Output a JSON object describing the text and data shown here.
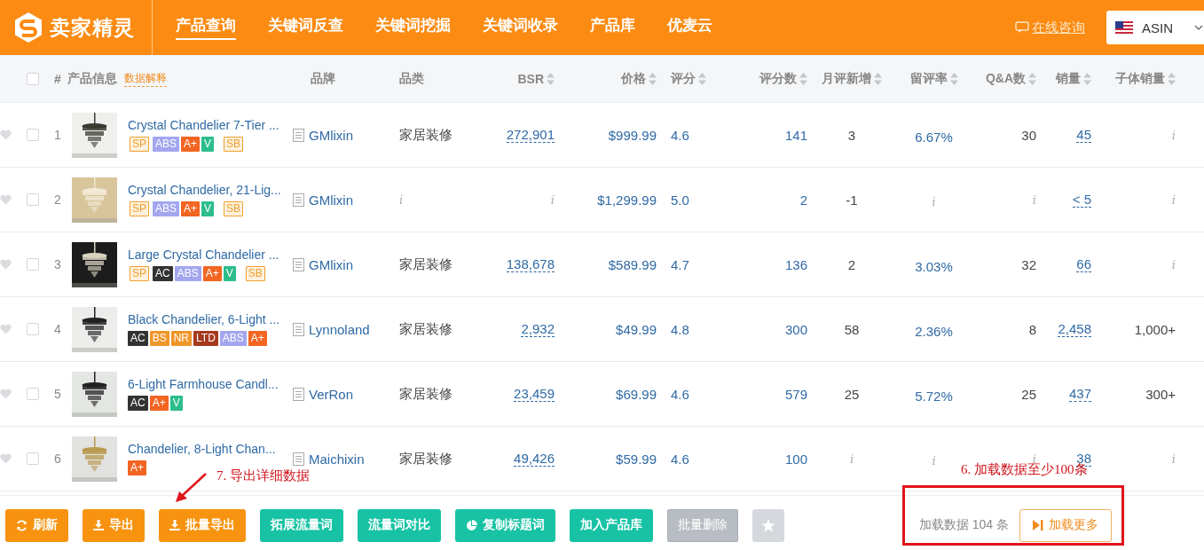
{
  "header": {
    "logo": "卖家精灵",
    "nav": [
      {
        "label": "产品查询",
        "selected": true
      },
      {
        "label": "关键词反查",
        "selected": false
      },
      {
        "label": "关键词挖掘",
        "selected": false
      },
      {
        "label": "关键词收录",
        "selected": false
      },
      {
        "label": "产品库",
        "selected": false
      },
      {
        "label": "优麦云",
        "selected": false
      }
    ],
    "consult": "在线咨询",
    "market_select": {
      "value": "ASIN"
    }
  },
  "table": {
    "select_all_checked": false,
    "columns": [
      {
        "label": "#",
        "sortable": false
      },
      {
        "label": "产品信息",
        "hint": "数据解释",
        "sortable": false
      },
      {
        "label": "品牌",
        "sortable": false
      },
      {
        "label": "品类",
        "sortable": false
      },
      {
        "label": "BSR",
        "sortable": true
      },
      {
        "label": "价格",
        "sortable": true
      },
      {
        "label": "评分",
        "sortable": true
      },
      {
        "label": "评分数",
        "sortable": true
      },
      {
        "label": "月评新增",
        "sortable": true
      },
      {
        "label": "留评率",
        "sortable": true
      },
      {
        "label": "Q&A数",
        "sortable": true
      },
      {
        "label": "销量",
        "sortable": true
      },
      {
        "label": "子体销量",
        "sortable": true
      }
    ],
    "rows": [
      {
        "favorited": false,
        "checked": false,
        "cells": [
          {
            "text": "1",
            "kind": "index"
          },
          {
            "kind": "product",
            "image": {
              "kind": "picture"
            },
            "title": "Crystal Chandelier 7-Tier ...",
            "tags": [
              {
                "text": "SP",
                "kind": "outline",
                "color": "#f0a030"
              },
              {
                "text": "ABS",
                "kind": "solid",
                "color": "#a3a6ee"
              },
              {
                "text": "A+",
                "kind": "solid",
                "color": "#f26522"
              },
              {
                "text": "V",
                "kind": "solid",
                "color": "#2dbd8a"
              },
              {
                "text": "SB",
                "kind": "outline",
                "color": "#f0a030"
              }
            ]
          },
          {
            "text": "GMlixin",
            "kind": "brand"
          },
          {
            "text": "家居装修",
            "kind": "plain"
          },
          {
            "text": "272,901",
            "kind": "link"
          },
          {
            "text": "$999.99",
            "kind": "value"
          },
          {
            "text": "4.6",
            "kind": "value"
          },
          {
            "text": "141",
            "kind": "value"
          },
          {
            "text": "3",
            "kind": "plain"
          },
          {
            "text": "6.67%",
            "kind": "value"
          },
          {
            "text": "30",
            "kind": "plain"
          },
          {
            "text": "45",
            "kind": "link"
          },
          {
            "text": "i",
            "kind": "na"
          }
        ]
      },
      {
        "favorited": false,
        "checked": false,
        "cells": [
          {
            "text": "2",
            "kind": "index"
          },
          {
            "kind": "product",
            "image": {
              "kind": "picture"
            },
            "title": "Crystal Chandelier, 21-Lig...",
            "tags": [
              {
                "text": "SP",
                "kind": "outline",
                "color": "#f0a030"
              },
              {
                "text": "ABS",
                "kind": "solid",
                "color": "#a3a6ee"
              },
              {
                "text": "A+",
                "kind": "solid",
                "color": "#f26522"
              },
              {
                "text": "V",
                "kind": "solid",
                "color": "#2dbd8a"
              },
              {
                "text": "SB",
                "kind": "outline",
                "color": "#f0a030"
              }
            ]
          },
          {
            "text": "GMlixin",
            "kind": "brand"
          },
          {
            "text": "i",
            "kind": "na"
          },
          {
            "text": "i",
            "kind": "na"
          },
          {
            "text": "$1,299.99",
            "kind": "value"
          },
          {
            "text": "5.0",
            "kind": "value"
          },
          {
            "text": "2",
            "kind": "value"
          },
          {
            "text": "-1",
            "kind": "plain"
          },
          {
            "text": "i",
            "kind": "na"
          },
          {
            "text": "i",
            "kind": "na"
          },
          {
            "text": "< 5",
            "kind": "link"
          },
          {
            "text": "i",
            "kind": "na"
          }
        ]
      },
      {
        "favorited": false,
        "checked": false,
        "cells": [
          {
            "text": "3",
            "kind": "index"
          },
          {
            "kind": "product",
            "image": {
              "kind": "picture"
            },
            "title": "Large Crystal Chandelier ...",
            "tags": [
              {
                "text": "SP",
                "kind": "outline",
                "color": "#f0a030"
              },
              {
                "text": "AC",
                "kind": "solid",
                "color": "#333333"
              },
              {
                "text": "ABS",
                "kind": "solid",
                "color": "#a3a6ee"
              },
              {
                "text": "A+",
                "kind": "solid",
                "color": "#f26522"
              },
              {
                "text": "V",
                "kind": "solid",
                "color": "#2dbd8a"
              },
              {
                "text": "SB",
                "kind": "outline",
                "color": "#f0a030"
              }
            ]
          },
          {
            "text": "GMlixin",
            "kind": "brand"
          },
          {
            "text": "家居装修",
            "kind": "plain"
          },
          {
            "text": "138,678",
            "kind": "link"
          },
          {
            "text": "$589.99",
            "kind": "value"
          },
          {
            "text": "4.7",
            "kind": "value"
          },
          {
            "text": "136",
            "kind": "value"
          },
          {
            "text": "2",
            "kind": "plain"
          },
          {
            "text": "3.03%",
            "kind": "value"
          },
          {
            "text": "32",
            "kind": "plain"
          },
          {
            "text": "66",
            "kind": "link"
          },
          {
            "text": "i",
            "kind": "na"
          }
        ]
      },
      {
        "favorited": false,
        "checked": false,
        "cells": [
          {
            "text": "4",
            "kind": "index"
          },
          {
            "kind": "product",
            "image": {
              "kind": "picture"
            },
            "title": "Black Chandelier, 6-Light ...",
            "tags": [
              {
                "text": "AC",
                "kind": "solid",
                "color": "#333333"
              },
              {
                "text": "BS",
                "kind": "solid",
                "color": "#f0962a"
              },
              {
                "text": "NR",
                "kind": "solid",
                "color": "#f0962a"
              },
              {
                "text": "LTD",
                "kind": "solid",
                "color": "#a63a1e"
              },
              {
                "text": "ABS",
                "kind": "solid",
                "color": "#a3a6ee"
              },
              {
                "text": "A+",
                "kind": "solid",
                "color": "#f26522"
              }
            ]
          },
          {
            "text": "Lynnoland",
            "kind": "brand"
          },
          {
            "text": "家居装修",
            "kind": "plain"
          },
          {
            "text": "2,932",
            "kind": "link"
          },
          {
            "text": "$49.99",
            "kind": "value"
          },
          {
            "text": "4.8",
            "kind": "value"
          },
          {
            "text": "300",
            "kind": "value"
          },
          {
            "text": "58",
            "kind": "plain"
          },
          {
            "text": "2.36%",
            "kind": "value"
          },
          {
            "text": "8",
            "kind": "plain"
          },
          {
            "text": "2,458",
            "kind": "link"
          },
          {
            "text": "1,000+",
            "kind": "plain"
          }
        ]
      },
      {
        "favorited": false,
        "checked": false,
        "cells": [
          {
            "text": "5",
            "kind": "index"
          },
          {
            "kind": "product",
            "image": {
              "kind": "picture"
            },
            "title": "6-Light Farmhouse Candl...",
            "tags": [
              {
                "text": "AC",
                "kind": "solid",
                "color": "#333333"
              },
              {
                "text": "A+",
                "kind": "solid",
                "color": "#f26522"
              },
              {
                "text": "V",
                "kind": "solid",
                "color": "#2dbd8a"
              }
            ]
          },
          {
            "text": "VerRon",
            "kind": "brand"
          },
          {
            "text": "家居装修",
            "kind": "plain"
          },
          {
            "text": "23,459",
            "kind": "link"
          },
          {
            "text": "$69.99",
            "kind": "value"
          },
          {
            "text": "4.6",
            "kind": "value"
          },
          {
            "text": "579",
            "kind": "value"
          },
          {
            "text": "25",
            "kind": "plain"
          },
          {
            "text": "5.72%",
            "kind": "value"
          },
          {
            "text": "25",
            "kind": "plain"
          },
          {
            "text": "437",
            "kind": "link"
          },
          {
            "text": "300+",
            "kind": "plain"
          }
        ]
      },
      {
        "favorited": false,
        "checked": false,
        "cells": [
          {
            "text": "6",
            "kind": "index"
          },
          {
            "kind": "product",
            "image": {
              "kind": "picture"
            },
            "title": "Chandelier, 8-Light Chan...",
            "tags": [
              {
                "text": "A+",
                "kind": "solid",
                "color": "#f26522"
              }
            ]
          },
          {
            "text": "Maichixin",
            "kind": "brand"
          },
          {
            "text": "家居装修",
            "kind": "plain"
          },
          {
            "text": "49,426",
            "kind": "link"
          },
          {
            "text": "$59.99",
            "kind": "value"
          },
          {
            "text": "4.6",
            "kind": "value"
          },
          {
            "text": "100",
            "kind": "value"
          },
          {
            "text": "i",
            "kind": "na"
          },
          {
            "text": "i",
            "kind": "na"
          },
          {
            "text": "i",
            "kind": "na"
          },
          {
            "text": "38",
            "kind": "link"
          },
          {
            "text": "i",
            "kind": "na"
          }
        ]
      }
    ]
  },
  "action_bar": {
    "buttons": [
      {
        "label": "刷新",
        "kind": "refresh",
        "color": "#f7930f",
        "disabled": false
      },
      {
        "label": "导出",
        "kind": "download",
        "color": "#f7930f",
        "disabled": false
      },
      {
        "label": "批量导出",
        "kind": "download",
        "color": "#f7930f",
        "disabled": false
      },
      {
        "label": "拓展流量词",
        "kind": "plain",
        "color": "#17c3a4",
        "disabled": false
      },
      {
        "label": "流量词对比",
        "kind": "plain",
        "color": "#17c3a4",
        "disabled": false
      },
      {
        "label": "复制标题词",
        "kind": "pie",
        "color": "#17c3a4",
        "disabled": false
      },
      {
        "label": "加入产品库",
        "kind": "plain",
        "color": "#17c3a4",
        "disabled": false
      },
      {
        "label": "批量删除",
        "kind": "plain",
        "color": "#b8bcc3",
        "disabled": true
      },
      {
        "kind": "star",
        "color": "#d5d8dd",
        "disabled": false
      }
    ],
    "loaded_text": "加载数据 104 条",
    "load_more": "加载更多"
  },
  "annotations": [
    {
      "kind": "arrow",
      "text": "7. 导出详细数据"
    },
    {
      "kind": "box",
      "text": "6. 加载数据至少100条"
    }
  ]
}
